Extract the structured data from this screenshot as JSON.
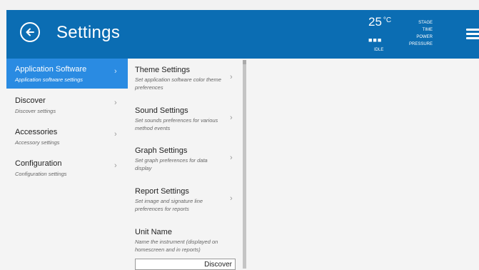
{
  "header": {
    "title": "Settings",
    "temperature": "25",
    "temperature_unit": "°C",
    "indicator_dots": "■■■",
    "state": "IDLE",
    "status_lines": [
      "STAGE",
      "TIME",
      "POWER",
      "PRESSURE"
    ],
    "back_icon": "back-arrow-icon",
    "menu_icon": "hamburger-menu-icon"
  },
  "sidebar": {
    "items": [
      {
        "label": "Application Software",
        "sub": "Application software settings",
        "active": true
      },
      {
        "label": "Discover",
        "sub": "Discover settings",
        "active": false
      },
      {
        "label": "Accessories",
        "sub": "Accessory settings",
        "active": false
      },
      {
        "label": "Configuration",
        "sub": "Configuration settings",
        "active": false
      }
    ]
  },
  "middle": {
    "items": [
      {
        "label": "Theme Settings",
        "sub": "Set application software color theme preferences"
      },
      {
        "label": "Sound Settings",
        "sub": "Set sounds preferences for various method events"
      },
      {
        "label": "Graph Settings",
        "sub": "Set graph preferences for data display"
      },
      {
        "label": "Report Settings",
        "sub": "Set image and signature line preferences for reports"
      },
      {
        "label": "Unit Name",
        "sub": "Name the instrument (displayed on homescreen and in reports)"
      }
    ],
    "unit_name_value": "Discover"
  },
  "colors": {
    "header_bg": "#0b6db3",
    "active_bg": "#2a8be2",
    "panel_bg": "#f4f4f4"
  },
  "chevron": "›"
}
